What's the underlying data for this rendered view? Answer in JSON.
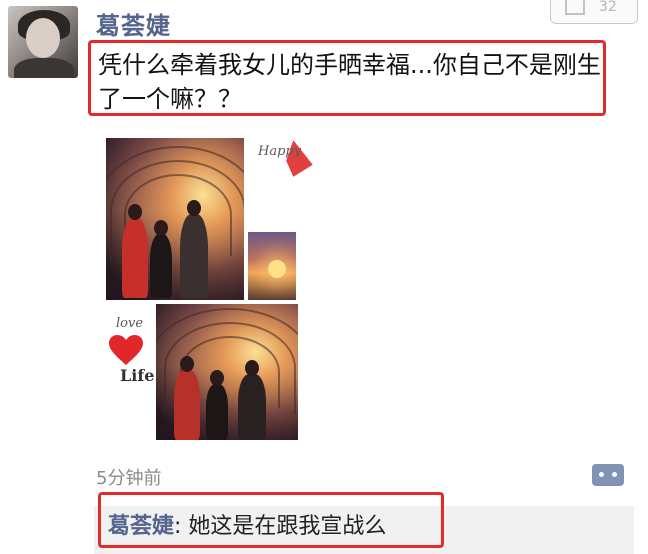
{
  "post": {
    "author": "葛荟婕",
    "text": "凭什么牵着我女儿的手晒幸福...你自己不是刚生了一个嘛？？",
    "timestamp": "5分钟前"
  },
  "top_badge": {
    "count": "32"
  },
  "images": {
    "happy_label": "Happy",
    "love_label": "love",
    "life_label": "Life"
  },
  "comment": {
    "author": "葛荟婕",
    "separator": ": ",
    "text": "她这是在跟我宣战么"
  },
  "colors": {
    "name_blue": "#55658e",
    "highlight_red": "#e32b2b",
    "timestamp_gray": "#8b8b8b"
  }
}
